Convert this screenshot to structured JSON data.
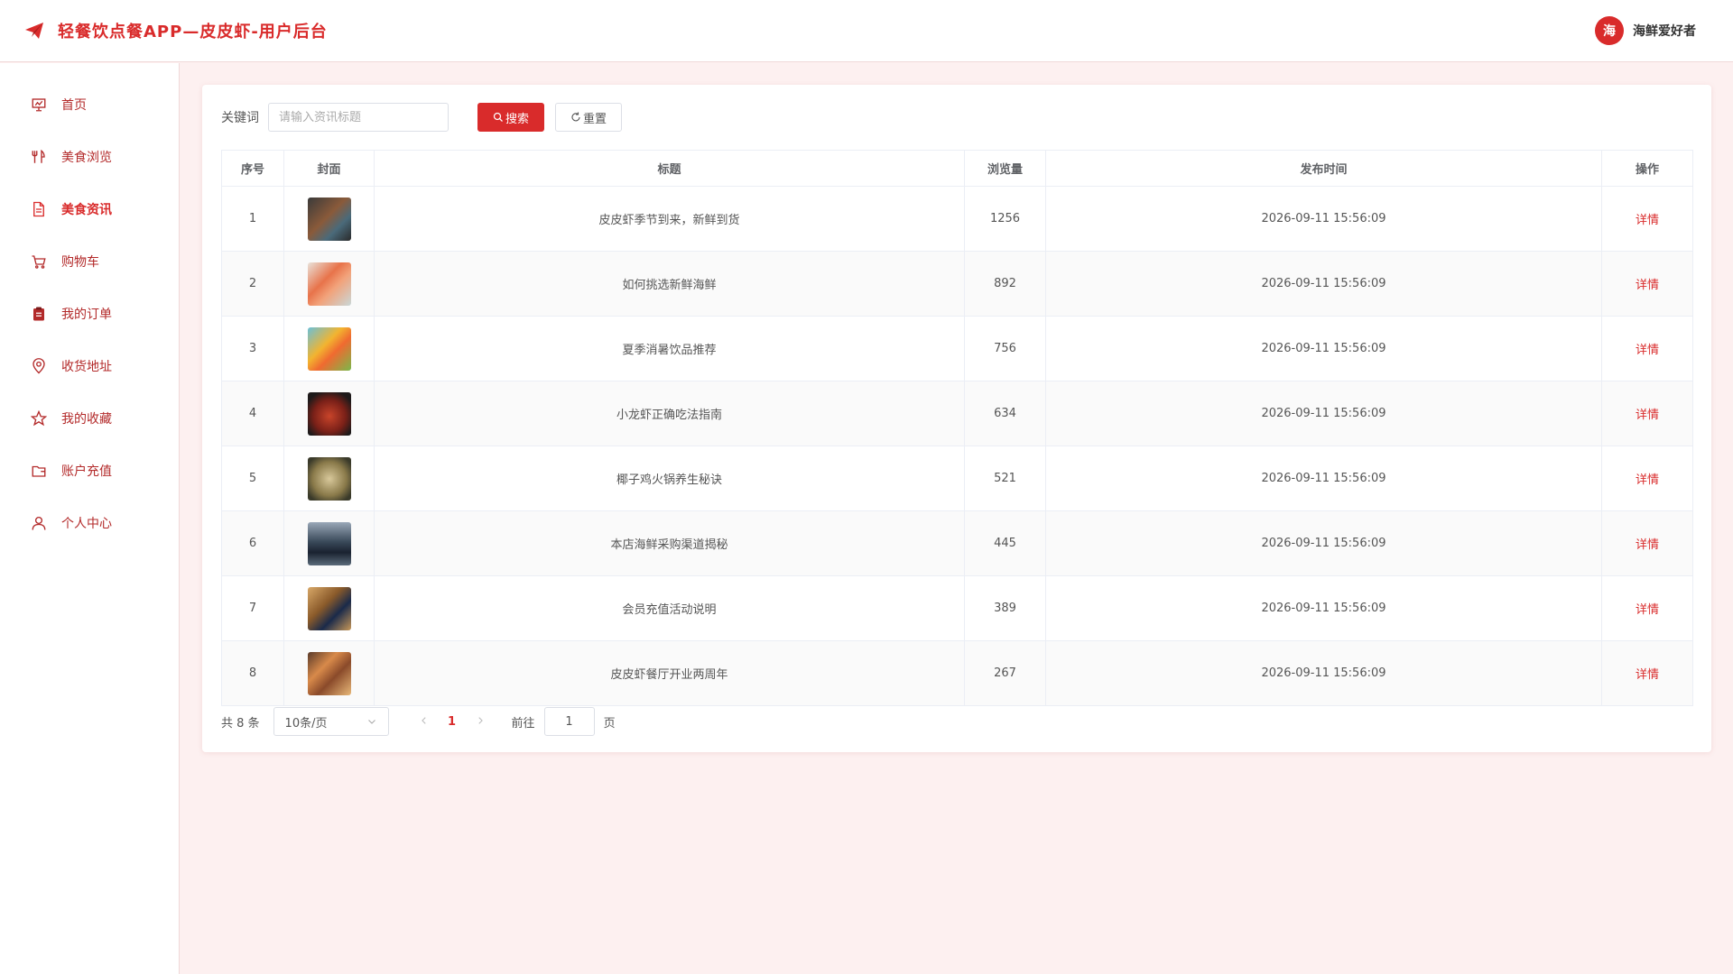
{
  "header": {
    "title": "轻餐饮点餐APP—皮皮虾-用户后台",
    "avatar_char": "海",
    "username": "海鲜爱好者"
  },
  "colors": {
    "accent": "#d92b2b",
    "background": "#fdf0f0"
  },
  "sidebar": {
    "items": [
      {
        "label": "首页",
        "icon": "presentation-icon"
      },
      {
        "label": "美食浏览",
        "icon": "fork-knife-icon"
      },
      {
        "label": "美食资讯",
        "icon": "document-icon",
        "active": true
      },
      {
        "label": "购物车",
        "icon": "cart-icon"
      },
      {
        "label": "我的订单",
        "icon": "clipboard-icon"
      },
      {
        "label": "收货地址",
        "icon": "location-icon"
      },
      {
        "label": "我的收藏",
        "icon": "star-icon"
      },
      {
        "label": "账户充值",
        "icon": "wallet-icon"
      },
      {
        "label": "个人中心",
        "icon": "user-icon"
      }
    ]
  },
  "search": {
    "label": "关键词",
    "placeholder": "请输入资讯标题",
    "value": "",
    "search_label": "搜索",
    "reset_label": "重置"
  },
  "table": {
    "columns": [
      "序号",
      "封面",
      "标题",
      "浏览量",
      "发布时间",
      "操作"
    ],
    "action_label": "详情",
    "rows": [
      {
        "index": "1",
        "title": "皮皮虾季节到来，新鲜到货",
        "views": "1256",
        "time": "2026-09-11 15:56:09"
      },
      {
        "index": "2",
        "title": "如何挑选新鲜海鲜",
        "views": "892",
        "time": "2026-09-11 15:56:09"
      },
      {
        "index": "3",
        "title": "夏季消暑饮品推荐",
        "views": "756",
        "time": "2026-09-11 15:56:09"
      },
      {
        "index": "4",
        "title": "小龙虾正确吃法指南",
        "views": "634",
        "time": "2026-09-11 15:56:09"
      },
      {
        "index": "5",
        "title": "椰子鸡火锅养生秘诀",
        "views": "521",
        "time": "2026-09-11 15:56:09"
      },
      {
        "index": "6",
        "title": "本店海鲜采购渠道揭秘",
        "views": "445",
        "time": "2026-09-11 15:56:09"
      },
      {
        "index": "7",
        "title": "会员充值活动说明",
        "views": "389",
        "time": "2026-09-11 15:56:09"
      },
      {
        "index": "8",
        "title": "皮皮虾餐厅开业两周年",
        "views": "267",
        "time": "2026-09-11 15:56:09"
      }
    ]
  },
  "pagination": {
    "total_text": "共 8 条",
    "page_size": "10条/页",
    "current_page": "1",
    "goto_label": "前往",
    "goto_value": "1",
    "page_suffix": "页"
  }
}
